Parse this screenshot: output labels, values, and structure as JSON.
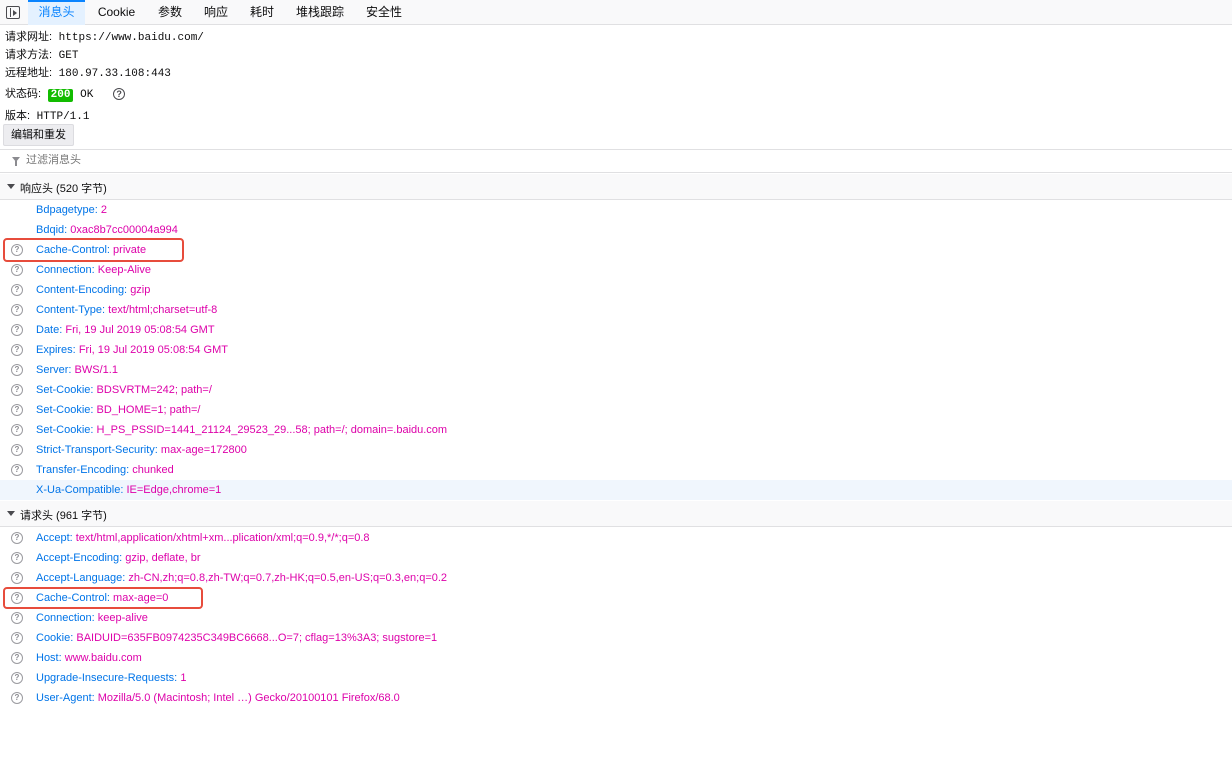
{
  "tabs": [
    {
      "label": "消息头",
      "active": true
    },
    {
      "label": "Cookie"
    },
    {
      "label": "参数"
    },
    {
      "label": "响应"
    },
    {
      "label": "耗时"
    },
    {
      "label": "堆栈跟踪"
    },
    {
      "label": "安全性"
    }
  ],
  "summary": {
    "url_label": "请求网址:",
    "url": "https://www.baidu.com/",
    "method_label": "请求方法:",
    "method": "GET",
    "remote_label": "远程地址:",
    "remote": "180.97.33.108:443",
    "status_label": "状态码:",
    "status_code": "200",
    "status_text": "OK",
    "version_label": "版本:",
    "version": "HTTP/1.1",
    "edit_resend": "编辑和重发"
  },
  "filter": {
    "placeholder": "过滤消息头"
  },
  "response_headers": {
    "title": "响应头 (520 字节)",
    "rows": [
      {
        "name": "Bdpagetype:",
        "value": "2",
        "help": false
      },
      {
        "name": "Bdqid:",
        "value": "0xac8b7cc00004a994",
        "help": false
      },
      {
        "name": "Cache-Control:",
        "value": "private",
        "help": true
      },
      {
        "name": "Connection:",
        "value": "Keep-Alive",
        "help": true
      },
      {
        "name": "Content-Encoding:",
        "value": "gzip",
        "help": true
      },
      {
        "name": "Content-Type:",
        "value": "text/html;charset=utf-8",
        "help": true
      },
      {
        "name": "Date:",
        "value": "Fri, 19 Jul 2019 05:08:54 GMT",
        "help": true
      },
      {
        "name": "Expires:",
        "value": "Fri, 19 Jul 2019 05:08:54 GMT",
        "help": true
      },
      {
        "name": "Server:",
        "value": "BWS/1.1",
        "help": true
      },
      {
        "name": "Set-Cookie:",
        "value": "BDSVRTM=242; path=/",
        "help": true
      },
      {
        "name": "Set-Cookie:",
        "value": "BD_HOME=1; path=/",
        "help": true
      },
      {
        "name": "Set-Cookie:",
        "value": "H_PS_PSSID=1441_21124_29523_29...58; path=/; domain=.baidu.com",
        "help": true
      },
      {
        "name": "Strict-Transport-Security:",
        "value": "max-age=172800",
        "help": true
      },
      {
        "name": "Transfer-Encoding:",
        "value": "chunked",
        "help": true
      },
      {
        "name": "X-Ua-Compatible:",
        "value": "IE=Edge,chrome=1",
        "help": false
      }
    ]
  },
  "request_headers": {
    "title": "请求头 (961 字节)",
    "rows": [
      {
        "name": "Accept:",
        "value": "text/html,application/xhtml+xm...plication/xml;q=0.9,*/*;q=0.8",
        "help": true
      },
      {
        "name": "Accept-Encoding:",
        "value": "gzip, deflate, br",
        "help": true
      },
      {
        "name": "Accept-Language:",
        "value": "zh-CN,zh;q=0.8,zh-TW;q=0.7,zh-HK;q=0.5,en-US;q=0.3,en;q=0.2",
        "help": true
      },
      {
        "name": "Cache-Control:",
        "value": "max-age=0",
        "help": true
      },
      {
        "name": "Connection:",
        "value": "keep-alive",
        "help": true
      },
      {
        "name": "Cookie:",
        "value": "BAIDUID=635FB0974235C349BC6668...O=7; cflag=13%3A3; sugstore=1",
        "help": true
      },
      {
        "name": "Host:",
        "value": "www.baidu.com",
        "help": true
      },
      {
        "name": "Upgrade-Insecure-Requests:",
        "value": "1",
        "help": true
      },
      {
        "name": "User-Agent:",
        "value": "Mozilla/5.0 (Macintosh; Intel …) Gecko/20100101 Firefox/68.0",
        "help": true
      }
    ]
  },
  "colors": {
    "accent": "#0a84ff",
    "header_name": "#0074e8",
    "header_value": "#dd00a9",
    "status_ok": "#12bc00",
    "annotation": "#e74c3c"
  }
}
